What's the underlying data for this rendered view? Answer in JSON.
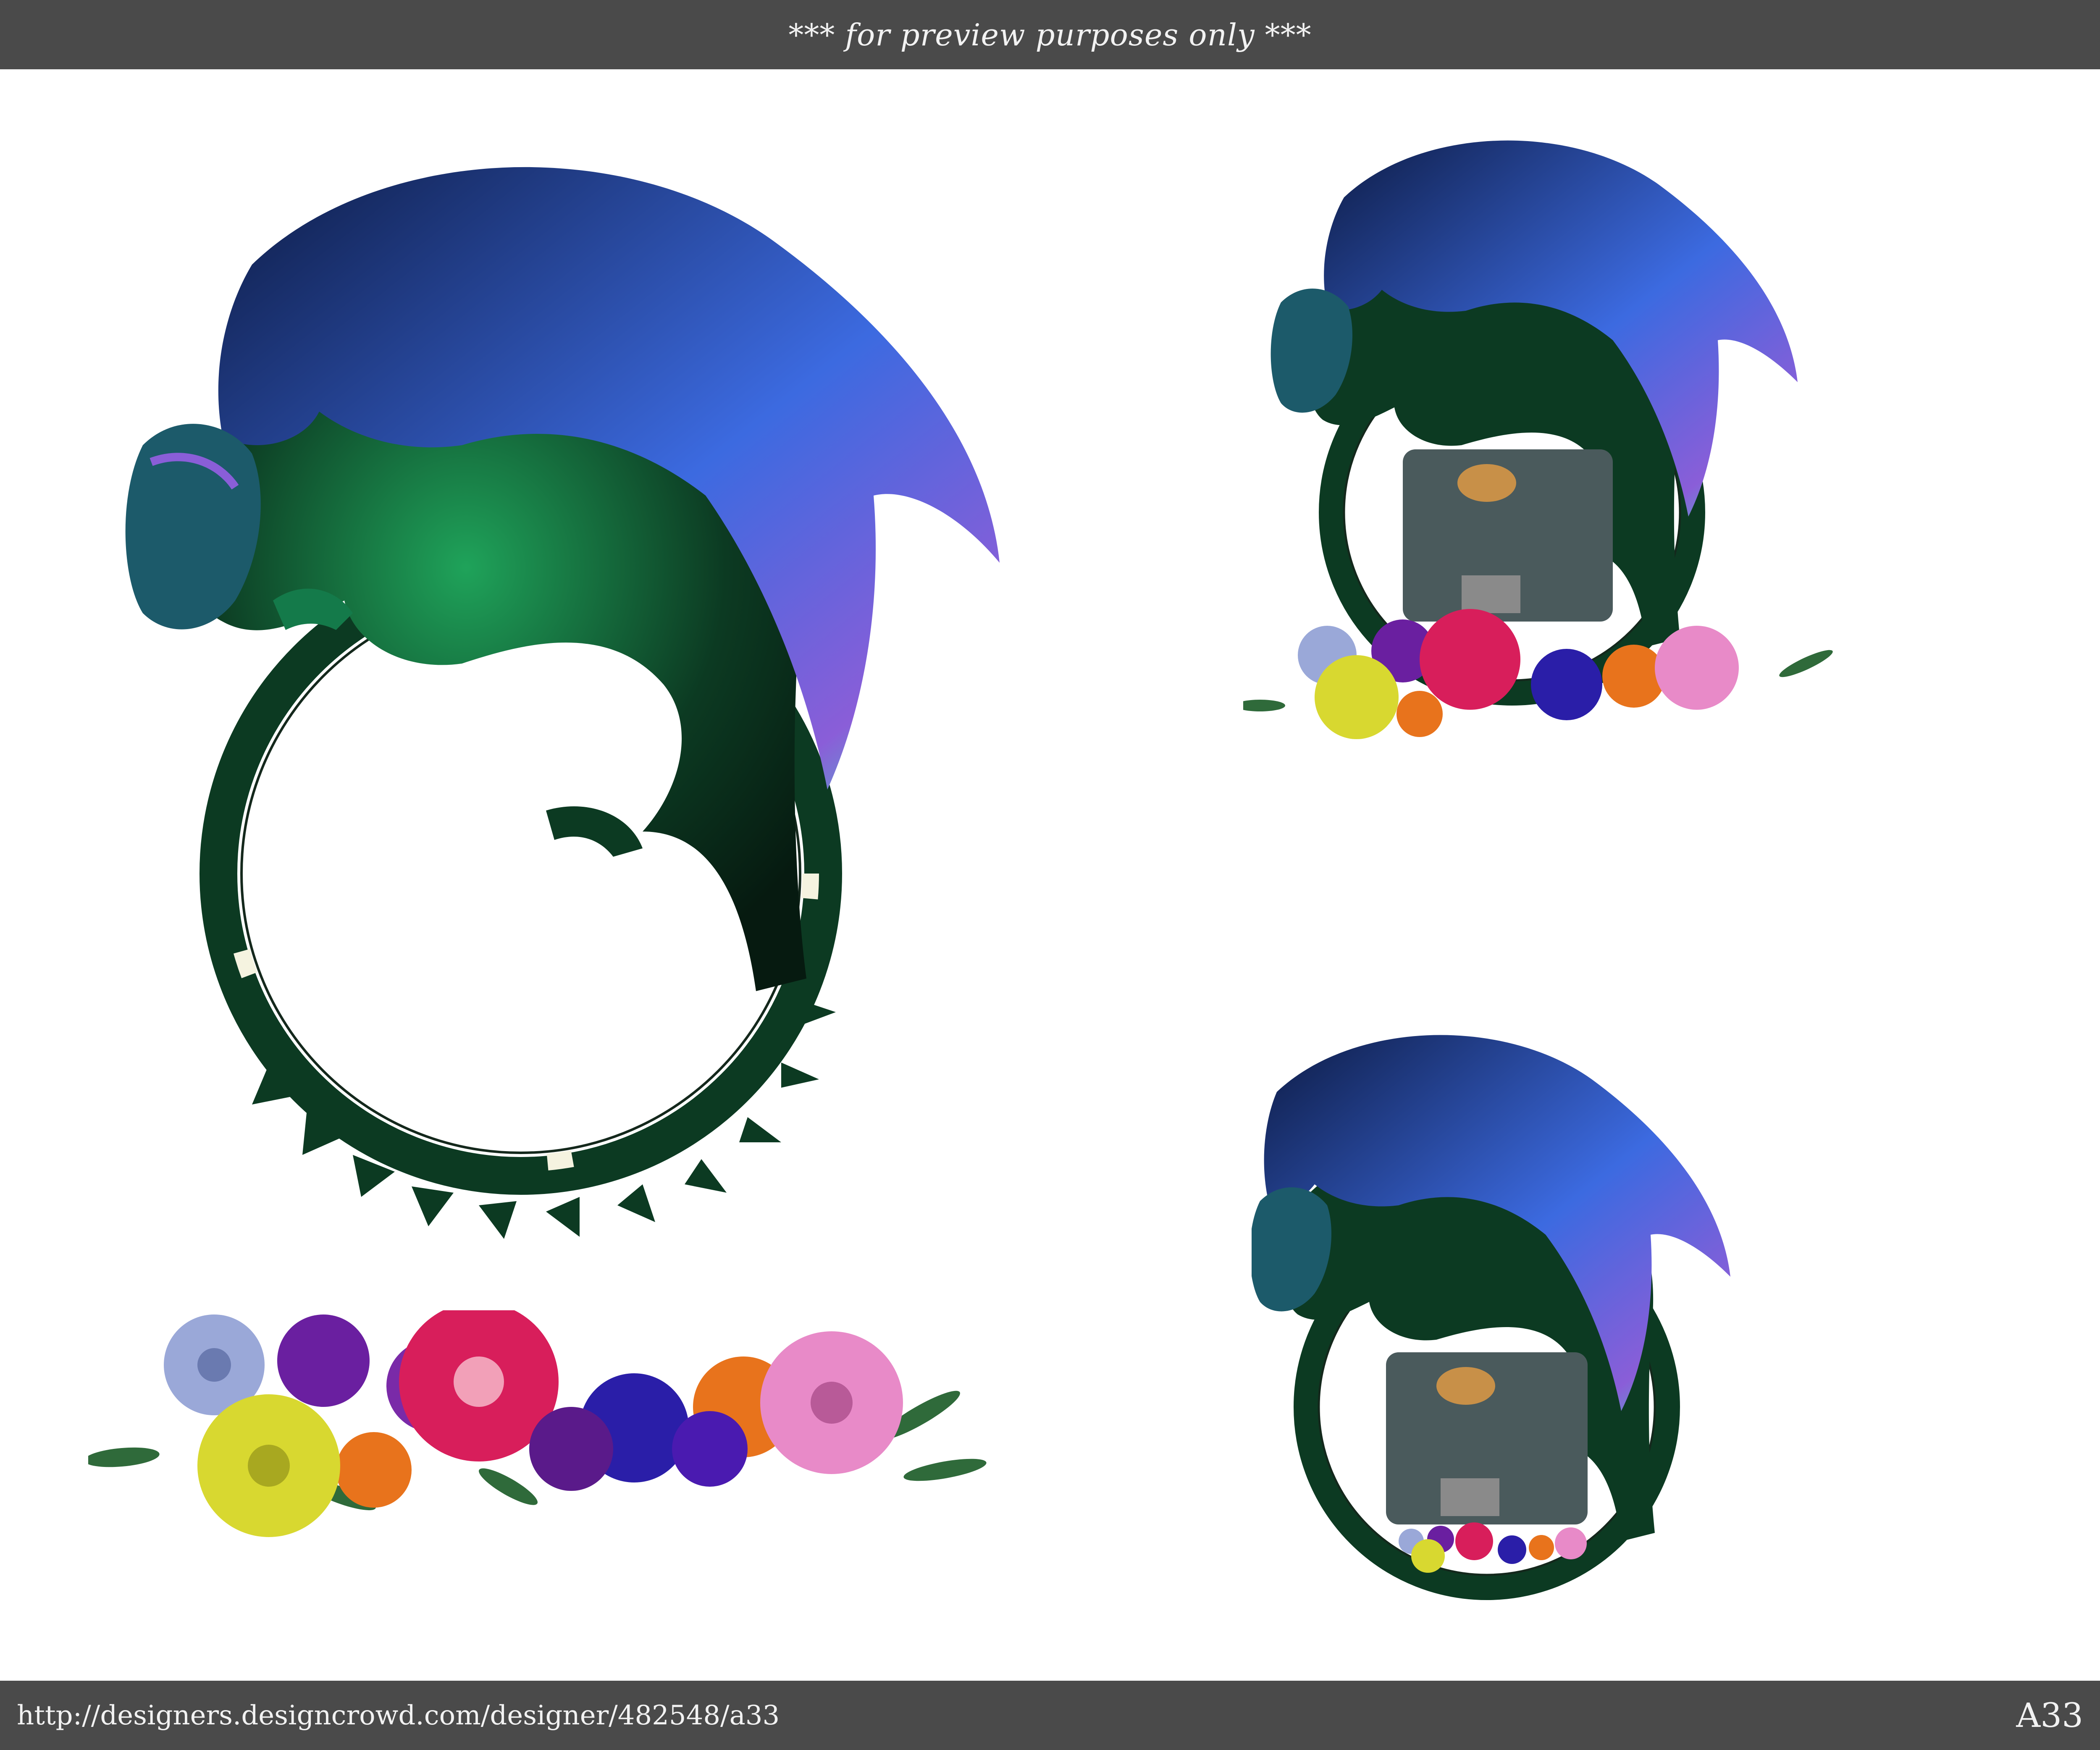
{
  "header": {
    "notice": "*** for preview purposes only ***"
  },
  "footer": {
    "url": "http://designers.designcrowd.com/designer/482548/a33",
    "code": "A33"
  },
  "artwork": [
    {
      "name": "dragon-main",
      "description_icon": "ouroboros-dragon-icon"
    },
    {
      "name": "flower-garland",
      "description_icon": "flower-garland-icon"
    },
    {
      "name": "dragon-with-flowers-preview",
      "description_icon": "dragon-composite-icon"
    },
    {
      "name": "dragon-with-small-flowers-preview",
      "description_icon": "dragon-composite-icon"
    }
  ],
  "colors": {
    "bar": "#4a4a4a",
    "dragon_body": "#0c3a22",
    "dragon_scale": "#1fa35a",
    "wing_dark": "#142a66",
    "wing_light": "#3c6ae0",
    "wing_edge": "#3fd3c8",
    "lily_pink": "#d81e5b",
    "orchid_purple": "#6a1fa0",
    "iris_blue": "#2a1ea8",
    "lily_yellow": "#d8d830",
    "poppy_orange": "#e8731c",
    "aster_blue": "#9aa8d8",
    "mum_pink": "#e88ac8",
    "leaf": "#2f6a3a"
  }
}
